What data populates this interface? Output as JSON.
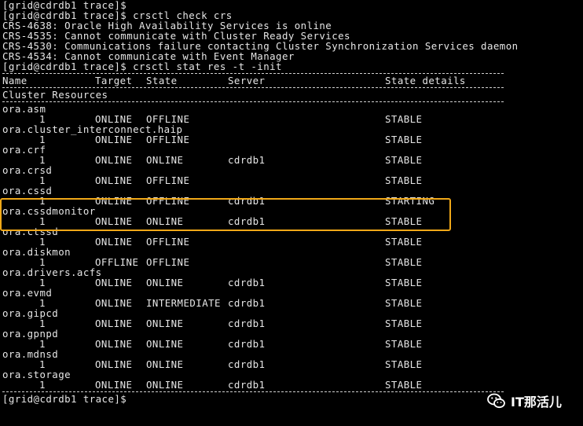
{
  "commands": [
    "[grid@cdrdb1 trace]$",
    "[grid@cdrdb1 trace]$ crsctl check crs",
    "CRS-4638: Oracle High Availability Services is online",
    "CRS-4535: Cannot communicate with Cluster Ready Services",
    "CRS-4530: Communications failure contacting Cluster Synchronization Services daemon",
    "CRS-4534: Cannot communicate with Event Manager",
    "[grid@cdrdb1 trace]$ crsctl stat res -t -init"
  ],
  "headers": {
    "name": "Name",
    "target": "Target",
    "state": "State",
    "server": "Server",
    "details": "State details"
  },
  "section_title": "Cluster Resources",
  "resources": [
    {
      "name": "ora.asm",
      "num": "1",
      "target": "ONLINE",
      "state": "OFFLINE",
      "server": "",
      "details": "STABLE"
    },
    {
      "name": "ora.cluster_interconnect.haip",
      "num": "1",
      "target": "ONLINE",
      "state": "OFFLINE",
      "server": "",
      "details": "STABLE"
    },
    {
      "name": "ora.crf",
      "num": "1",
      "target": "ONLINE",
      "state": "ONLINE",
      "server": "cdrdb1",
      "details": "STABLE"
    },
    {
      "name": "ora.crsd",
      "num": "1",
      "target": "ONLINE",
      "state": "OFFLINE",
      "server": "",
      "details": "STABLE"
    },
    {
      "name": "ora.cssd",
      "num": "1",
      "target": "ONLINE",
      "state": "OFFLINE",
      "server": "cdrdb1",
      "details": "STARTING"
    },
    {
      "name": "ora.cssdmonitor",
      "num": "1",
      "target": "ONLINE",
      "state": "ONLINE",
      "server": "cdrdb1",
      "details": "STABLE"
    },
    {
      "name": "ora.ctssd",
      "num": "1",
      "target": "ONLINE",
      "state": "OFFLINE",
      "server": "",
      "details": "STABLE"
    },
    {
      "name": "ora.diskmon",
      "num": "1",
      "target": "OFFLINE",
      "state": "OFFLINE",
      "server": "",
      "details": "STABLE"
    },
    {
      "name": "ora.drivers.acfs",
      "num": "1",
      "target": "ONLINE",
      "state": "ONLINE",
      "server": "cdrdb1",
      "details": "STABLE"
    },
    {
      "name": "ora.evmd",
      "num": "1",
      "target": "ONLINE",
      "state": "INTERMEDIATE",
      "server": "cdrdb1",
      "details": "STABLE"
    },
    {
      "name": "ora.gipcd",
      "num": "1",
      "target": "ONLINE",
      "state": "ONLINE",
      "server": "cdrdb1",
      "details": "STABLE"
    },
    {
      "name": "ora.gpnpd",
      "num": "1",
      "target": "ONLINE",
      "state": "ONLINE",
      "server": "cdrdb1",
      "details": "STABLE"
    },
    {
      "name": "ora.mdnsd",
      "num": "1",
      "target": "ONLINE",
      "state": "ONLINE",
      "server": "cdrdb1",
      "details": "STABLE"
    },
    {
      "name": "ora.storage",
      "num": "1",
      "target": "ONLINE",
      "state": "ONLINE",
      "server": "cdrdb1",
      "details": "STABLE"
    }
  ],
  "final_prompt": "[grid@cdrdb1 trace]$",
  "watermark": {
    "icon": "wechat-icon",
    "text": "IT那活儿"
  },
  "colors": {
    "background": "#000000",
    "text": "#e6e6e6",
    "highlight": "#f0a818"
  }
}
